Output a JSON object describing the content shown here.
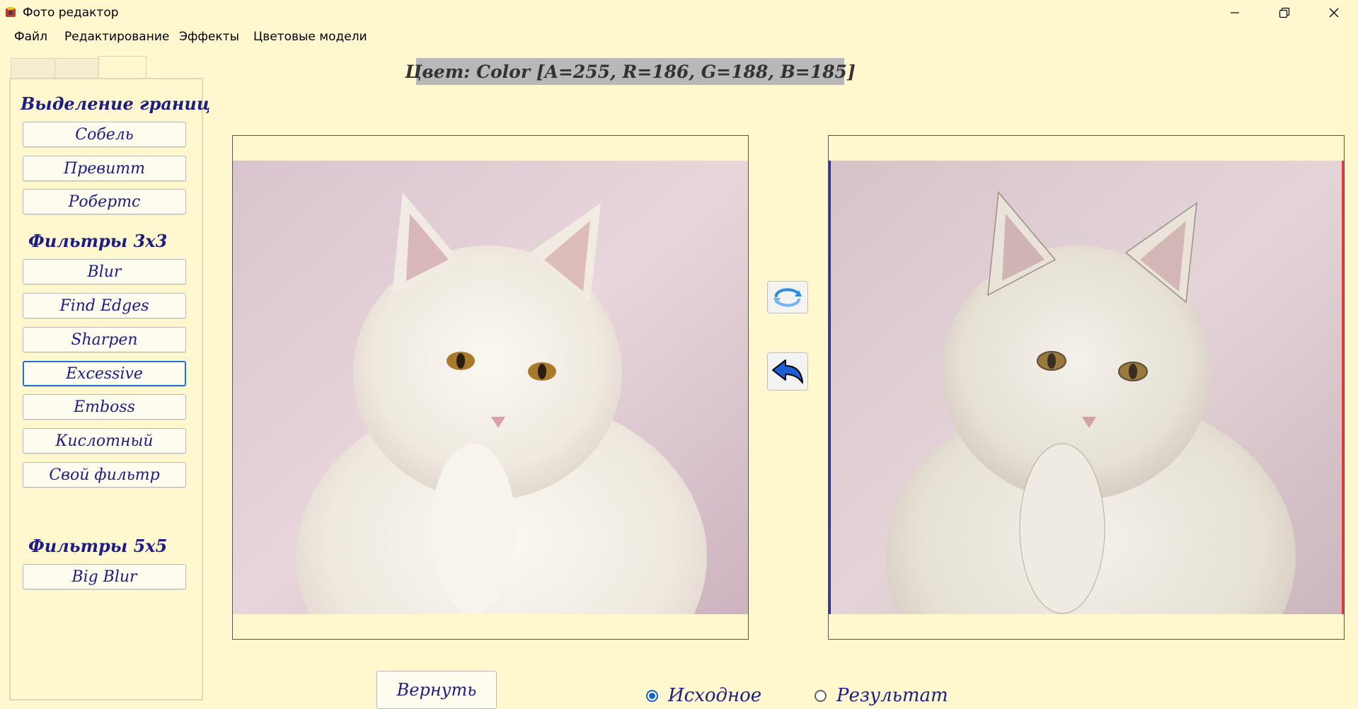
{
  "window": {
    "title": "Фото редактор"
  },
  "menu": [
    "Файл",
    "Редактирование",
    "Эффекты",
    "Цветовые модели"
  ],
  "color_info": "Цвет: Color [A=255, R=186, G=188, B=185]",
  "panel": {
    "headings": {
      "edges": "Выделение границ",
      "filters3": "Фильтры 3x3",
      "filters5": "Фильтры 5x5"
    },
    "edge_buttons": [
      "Собель",
      "Превитт",
      "Робертс"
    ],
    "filter3_buttons": [
      "Blur",
      "Find Edges",
      "Sharpen",
      "Excessive",
      "Emboss",
      "Кислотный",
      "Свой фильтр"
    ],
    "filter5_buttons": [
      "Big Blur"
    ]
  },
  "actions": {
    "return_label": "Вернуть"
  },
  "view_mode": {
    "source_label": "Исходное",
    "result_label": "Результат",
    "selected": "Исходное"
  },
  "icons": {
    "swap": "swap-arrows-icon",
    "undo": "undo-arrow-icon"
  },
  "colors": {
    "accent_text": "#1d1d88",
    "background": "#fff8cf",
    "focus": "#1e6fd8"
  }
}
